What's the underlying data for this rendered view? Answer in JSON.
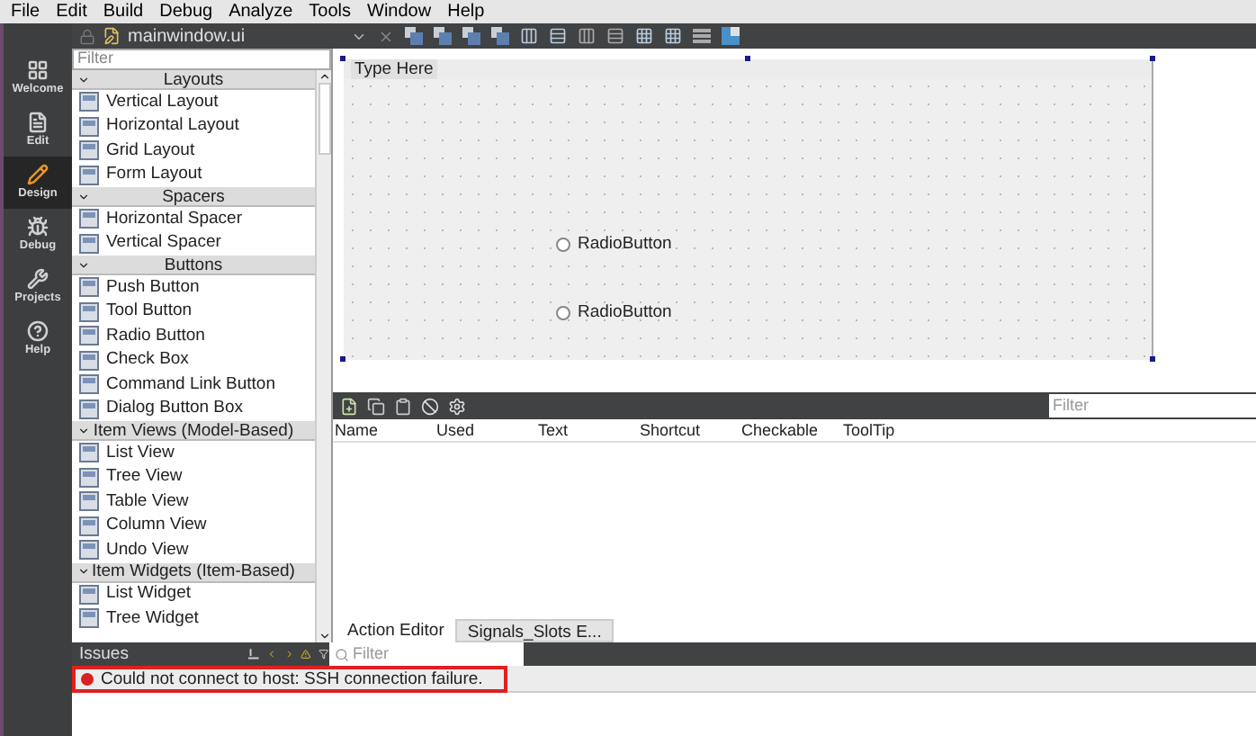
{
  "menu_bar": [
    "File",
    "Edit",
    "Build",
    "Debug",
    "Analyze",
    "Tools",
    "Window",
    "Help"
  ],
  "mode_bar": [
    {
      "label": "Welcome",
      "kind": "grid",
      "selected": false
    },
    {
      "label": "Edit",
      "kind": "doc",
      "selected": false
    },
    {
      "label": "Design",
      "kind": "pencil",
      "selected": true
    },
    {
      "label": "Debug",
      "kind": "bug",
      "selected": false
    },
    {
      "label": "Projects",
      "kind": "wrench",
      "selected": false
    },
    {
      "label": "Help",
      "kind": "help",
      "selected": false
    }
  ],
  "document": {
    "title": "mainwindow.ui"
  },
  "widget_box": {
    "filter_placeholder": "Filter",
    "categories": [
      {
        "title": "Layouts",
        "expanded": true,
        "items": [
          "Vertical Layout",
          "Horizontal Layout",
          "Grid Layout",
          "Form Layout"
        ]
      },
      {
        "title": "Spacers",
        "expanded": true,
        "items": [
          "Horizontal Spacer",
          "Vertical Spacer"
        ]
      },
      {
        "title": "Buttons",
        "expanded": true,
        "items": [
          "Push Button",
          "Tool Button",
          "Radio Button",
          "Check Box",
          "Command Link Button",
          "Dialog Button Box"
        ]
      },
      {
        "title": "Item Views (Model-Based)",
        "expanded": true,
        "items": [
          "List View",
          "Tree View",
          "Table View",
          "Column View",
          "Undo View"
        ]
      },
      {
        "title": "Item Widgets (Item-Based)",
        "expanded": true,
        "items": [
          "List Widget",
          "Tree Widget"
        ]
      }
    ]
  },
  "form": {
    "menu_placeholder": "Type Here",
    "radio_buttons": [
      {
        "label": "RadioButton",
        "checked": false
      },
      {
        "label": "RadioButton",
        "checked": false
      }
    ]
  },
  "action_editor": {
    "filter_placeholder": "Filter",
    "columns": [
      "Name",
      "Used",
      "Text",
      "Shortcut",
      "Checkable",
      "ToolTip"
    ],
    "tabs": [
      {
        "label": "Action Editor",
        "selected": true
      },
      {
        "label": "Signals_Slots E...",
        "selected": false
      }
    ]
  },
  "issues": {
    "title": "Issues",
    "filter_placeholder": "Filter",
    "items": [
      {
        "kind": "error",
        "text": "Could not connect to host: SSH connection failure.",
        "highlighted": true
      }
    ]
  }
}
